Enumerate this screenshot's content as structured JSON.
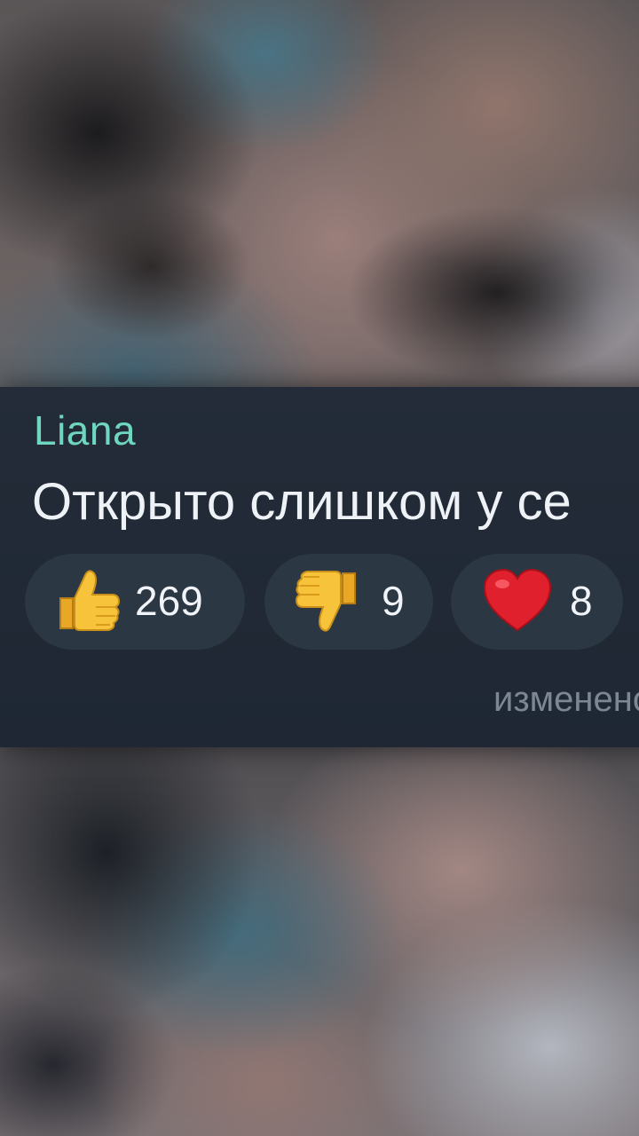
{
  "message": {
    "sender_name": "Liana",
    "text": "Открыто слишком у се",
    "edited_label": "изменено"
  },
  "reactions": [
    {
      "emoji": "thumbs-up-icon",
      "count": "269"
    },
    {
      "emoji": "thumbs-down-icon",
      "count": "9"
    },
    {
      "emoji": "red-heart-icon",
      "count": "8"
    }
  ],
  "colors": {
    "sender": "#6fd6c0",
    "card_background": "#1f2937",
    "pill_background": "#2c3744",
    "message_text": "#eef2f6",
    "edited_text": "#7d8794",
    "heart": "#e0202c",
    "thumb": "#f4c030"
  }
}
